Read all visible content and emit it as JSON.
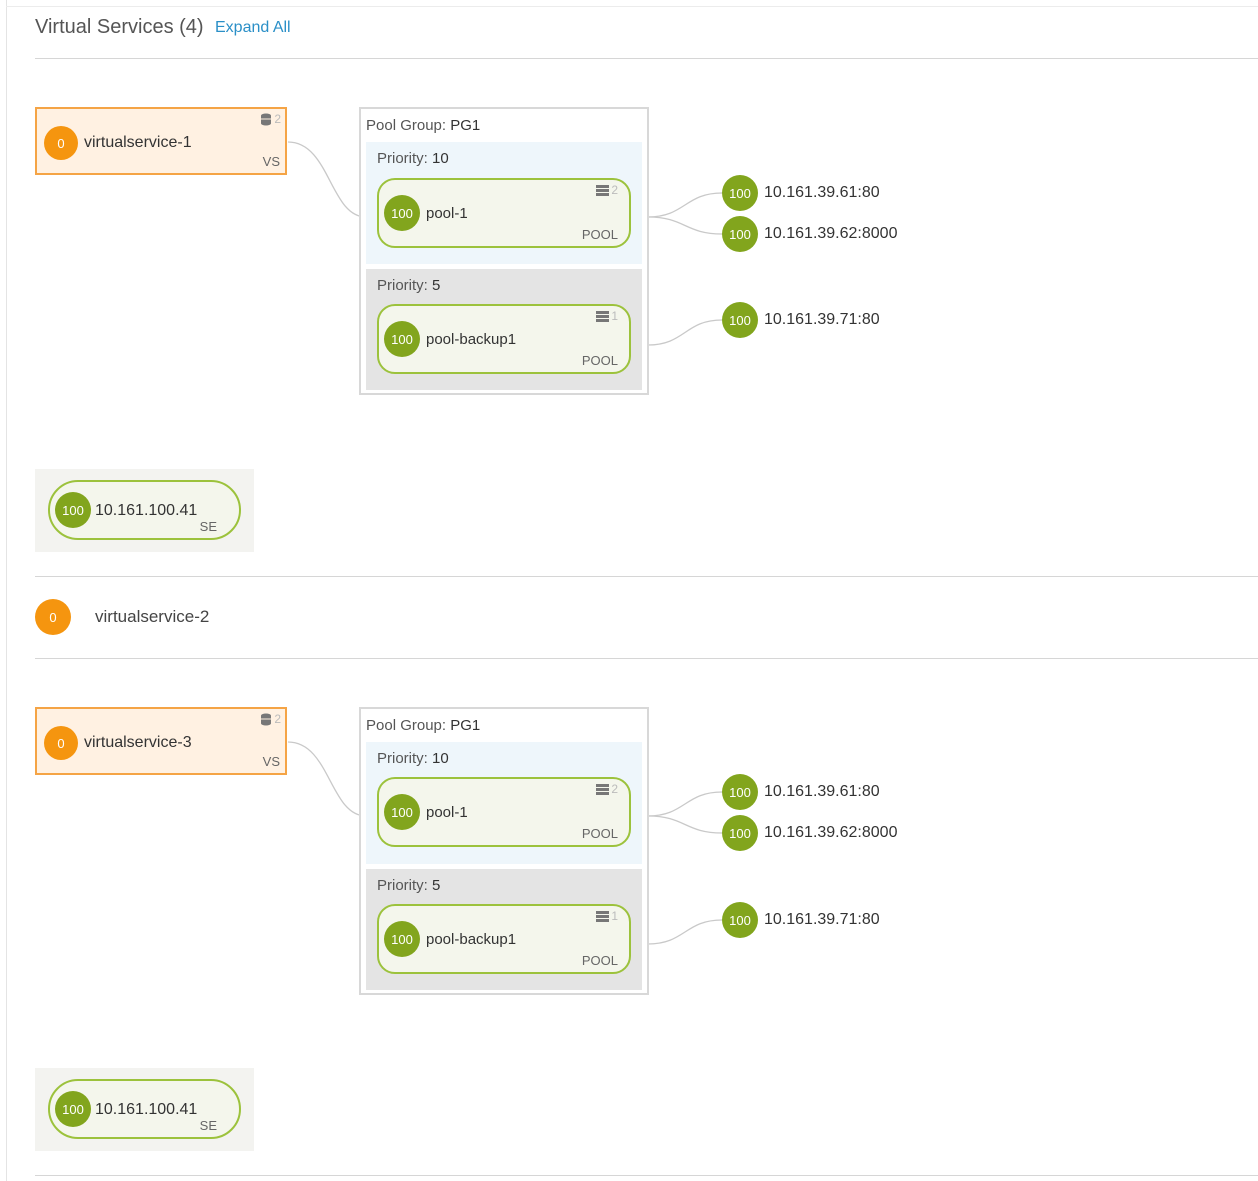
{
  "header": {
    "title": "Virtual Services (4)",
    "expand_all": "Expand All"
  },
  "services": [
    {
      "name": "virtualservice-1",
      "score": "0",
      "tag": "VS",
      "count": "2",
      "pool_group": {
        "label": "Pool Group:",
        "name": "PG1",
        "priorities": [
          {
            "label": "Priority:",
            "value": "10",
            "pool": {
              "name": "pool-1",
              "score": "100",
              "tag": "POOL",
              "count": "2"
            },
            "servers": [
              {
                "score": "100",
                "addr": "10.161.39.61:80"
              },
              {
                "score": "100",
                "addr": "10.161.39.62:8000"
              }
            ]
          },
          {
            "label": "Priority:",
            "value": "5",
            "pool": {
              "name": "pool-backup1",
              "score": "100",
              "tag": "POOL",
              "count": "1"
            },
            "servers": [
              {
                "score": "100",
                "addr": "10.161.39.71:80"
              }
            ]
          }
        ]
      },
      "se": {
        "score": "100",
        "addr": "10.161.100.41",
        "tag": "SE"
      }
    },
    {
      "name": "virtualservice-2",
      "score": "0"
    },
    {
      "name": "virtualservice-3",
      "score": "0",
      "tag": "VS",
      "count": "2",
      "pool_group": {
        "label": "Pool Group:",
        "name": "PG1",
        "priorities": [
          {
            "label": "Priority:",
            "value": "10",
            "pool": {
              "name": "pool-1",
              "score": "100",
              "tag": "POOL",
              "count": "2"
            },
            "servers": [
              {
                "score": "100",
                "addr": "10.161.39.61:80"
              },
              {
                "score": "100",
                "addr": "10.161.39.62:8000"
              }
            ]
          },
          {
            "label": "Priority:",
            "value": "5",
            "pool": {
              "name": "pool-backup1",
              "score": "100",
              "tag": "POOL",
              "count": "1"
            },
            "servers": [
              {
                "score": "100",
                "addr": "10.161.39.71:80"
              }
            ]
          }
        ]
      },
      "se": {
        "score": "100",
        "addr": "10.161.100.41",
        "tag": "SE"
      }
    }
  ],
  "colors": {
    "vs_accent": "#f5950f",
    "health_good": "#82a51d",
    "link": "#2a8fc7"
  }
}
